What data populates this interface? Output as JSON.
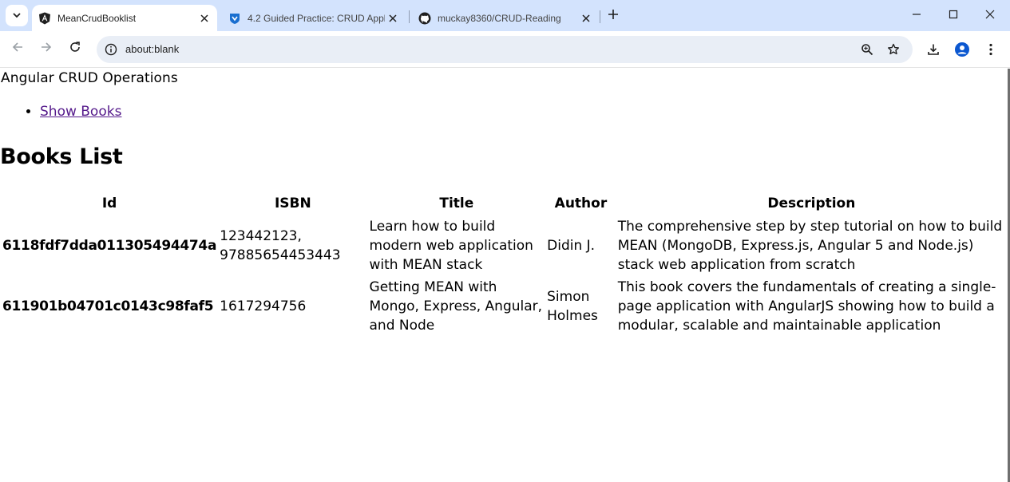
{
  "browser": {
    "tabs": [
      {
        "title": "MeanCrudBooklist",
        "icon": "angular-icon",
        "active": true
      },
      {
        "title": "4.2 Guided Practice: CRUD Appl",
        "icon": "shield-icon",
        "active": false
      },
      {
        "title": "muckay8360/CRUD-Reading",
        "icon": "github-icon",
        "active": false
      }
    ],
    "address": "about:blank"
  },
  "page": {
    "app_title": "Angular CRUD Operations",
    "nav": {
      "show_books": "Show Books"
    },
    "heading": "Books List",
    "table": {
      "headers": [
        "Id",
        "ISBN",
        "Title",
        "Author",
        "Description"
      ],
      "rows": [
        {
          "id": "6118fdf7dda011305494474a",
          "isbn": "123442123, 97885654453443",
          "title": "Learn how to build modern web application with MEAN stack",
          "author": "Didin J.",
          "description": "The comprehensive step by step tutorial on how to build MEAN (MongoDB, Express.js, Angular 5 and Node.js) stack web application from scratch"
        },
        {
          "id": "611901b04701c0143c98faf5",
          "isbn": "1617294756",
          "title": "Getting MEAN with Mongo, Express, Angular, and Node",
          "author": "Simon Holmes",
          "description": "This book covers the fundamentals of creating a single-page application with AngularJS showing how to build a modular, scalable and maintainable application"
        }
      ]
    }
  }
}
